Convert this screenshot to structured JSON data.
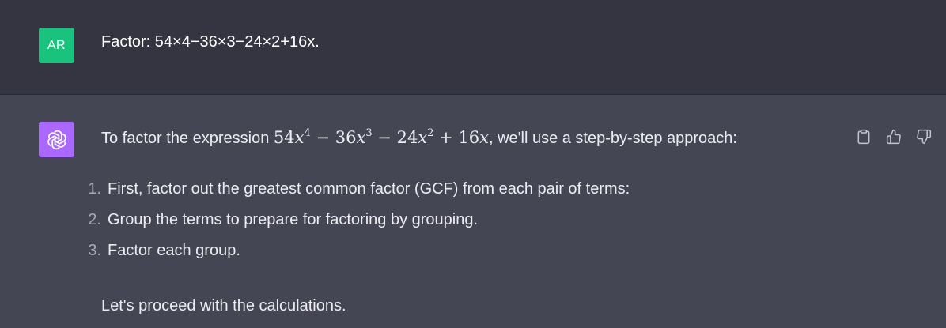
{
  "user_message": {
    "avatar_initials": "AR",
    "text": "Factor: 54×4−36×3−24×2+16x."
  },
  "assistant_message": {
    "intro_before": "To factor the expression ",
    "intro_after": ", we'll use a step-by-step approach:",
    "math": {
      "t1_coef": "54",
      "t1_var": "x",
      "t1_exp": "4",
      "op1": "−",
      "t2_coef": "36",
      "t2_var": "x",
      "t2_exp": "3",
      "op2": "−",
      "t3_coef": "24",
      "t3_var": "x",
      "t3_exp": "2",
      "op3": "+",
      "t4_coef": "16",
      "t4_var": "x"
    },
    "steps": [
      {
        "num": "1.",
        "text": "First, factor out the greatest common factor (GCF) from each pair of terms:"
      },
      {
        "num": "2.",
        "text": "Group the terms to prepare for factoring by grouping."
      },
      {
        "num": "3.",
        "text": "Factor each group."
      }
    ],
    "closing": "Let's proceed with the calculations."
  },
  "icons": {
    "copy": "clipboard-icon",
    "like": "thumbs-up-icon",
    "dislike": "thumbs-down-icon",
    "assistant_logo": "openai-logo-icon"
  },
  "colors": {
    "user_bg": "#343541",
    "assistant_bg": "#444654",
    "user_avatar": "#19c37d",
    "assistant_avatar": "#ab68ff"
  }
}
